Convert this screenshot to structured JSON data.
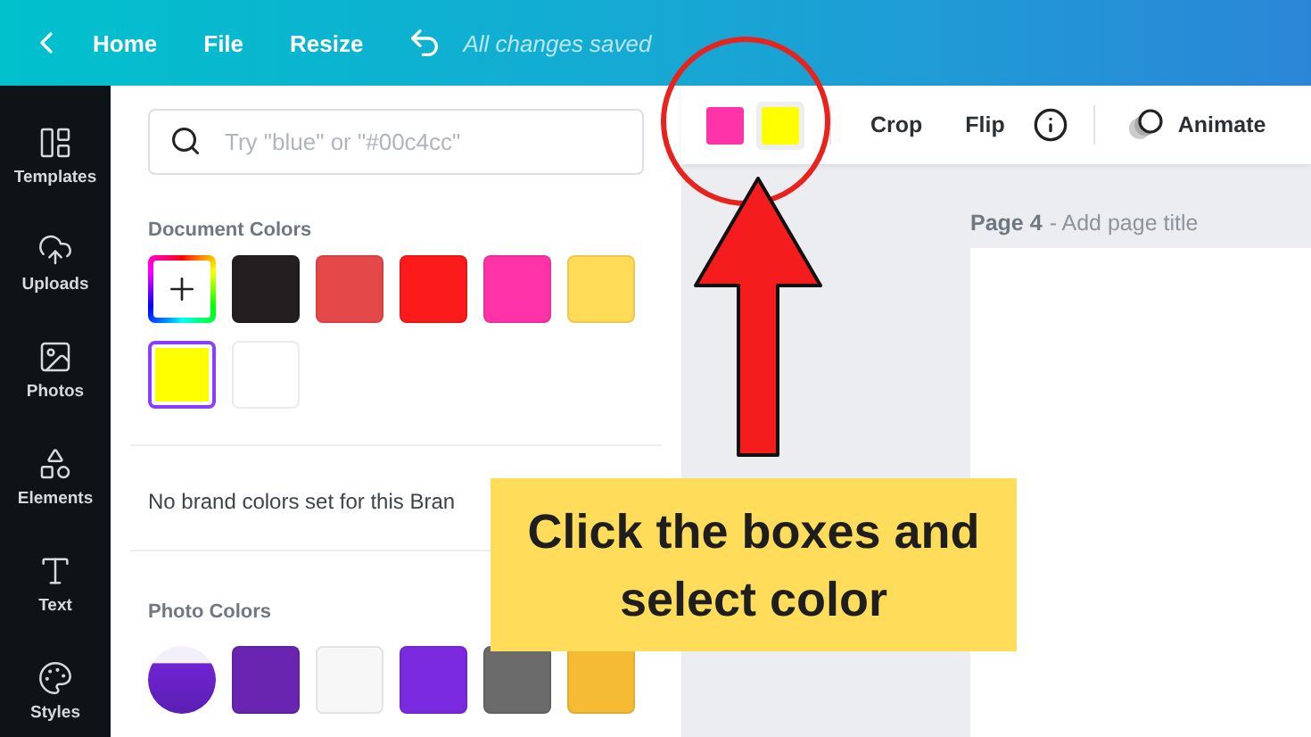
{
  "topbar": {
    "nav": [
      "Home",
      "File",
      "Resize"
    ],
    "status": "All changes saved"
  },
  "sidebar": {
    "items": [
      {
        "label": "Templates"
      },
      {
        "label": "Uploads"
      },
      {
        "label": "Photos"
      },
      {
        "label": "Elements"
      },
      {
        "label": "Text"
      },
      {
        "label": "Styles"
      }
    ]
  },
  "color_panel": {
    "search": {
      "placeholder": "Try \"blue\" or \"#00c4cc\""
    },
    "document_colors": {
      "heading": "Document Colors",
      "swatches": [
        {
          "kind": "add"
        },
        {
          "kind": "color",
          "color": "#231f20",
          "selected": false
        },
        {
          "kind": "color",
          "color": "#e54848",
          "selected": false
        },
        {
          "kind": "color",
          "color": "#fb1b1b",
          "selected": false
        },
        {
          "kind": "color",
          "color": "#ff33a8",
          "selected": false
        },
        {
          "kind": "color",
          "color": "#ffdb58",
          "selected": false
        },
        {
          "kind": "color",
          "color": "#ffff00",
          "selected": true
        },
        {
          "kind": "color",
          "color": "#ffffff",
          "selected": false
        }
      ]
    },
    "brand_note": "No brand colors set for this Bran",
    "photo_colors": {
      "heading": "Photo Colors",
      "swatches": [
        {
          "kind": "photo"
        },
        {
          "kind": "color",
          "color": "#6a25b0"
        },
        {
          "kind": "color",
          "color": "#f7f7f7"
        },
        {
          "kind": "color",
          "color": "#7b2ae0"
        },
        {
          "kind": "color",
          "color": "#6b6b6b"
        },
        {
          "kind": "color",
          "color": "#f5bb35"
        }
      ]
    }
  },
  "toolbar": {
    "swatches": [
      {
        "color": "#ff33a8",
        "selected": false
      },
      {
        "color": "#ffff00",
        "selected": true
      }
    ],
    "buttons": [
      "Crop",
      "Flip"
    ],
    "animate": "Animate"
  },
  "canvas": {
    "page_label": "Page 4",
    "page_title_hint": "- Add page title"
  },
  "callout": {
    "lines": [
      "Click the boxes and",
      "select color"
    ]
  }
}
